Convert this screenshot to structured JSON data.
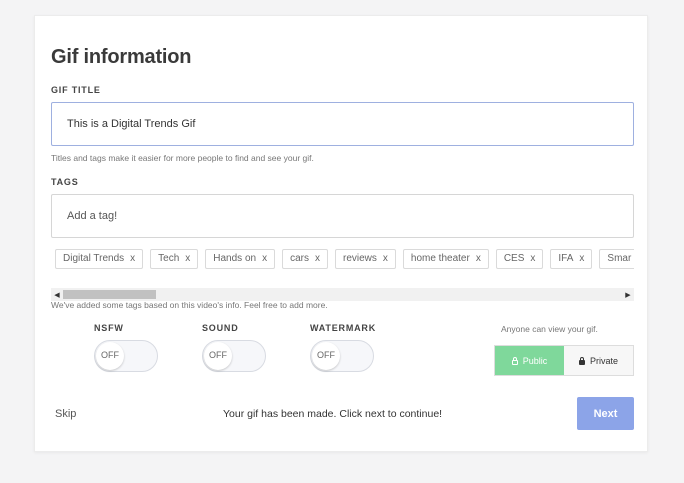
{
  "header": {
    "title": "Gif information"
  },
  "gif_title": {
    "label": "GIF TITLE",
    "value": "This is a Digital Trends Gif",
    "helper": "Titles and tags make it easier for more people to find and see your gif."
  },
  "tags": {
    "label": "TAGS",
    "placeholder": "Add a tag!",
    "remove_glyph": "x",
    "items": [
      "Digital Trends",
      "Tech",
      "Hands on",
      "cars",
      "reviews",
      "home theater",
      "CES",
      "IFA",
      "Smar"
    ],
    "helper": "We've added some tags based on this video's info. Feel free to add more."
  },
  "toggles": [
    {
      "label": "NSFW",
      "state": "OFF"
    },
    {
      "label": "SOUND",
      "state": "OFF"
    },
    {
      "label": "WATERMARK",
      "state": "OFF"
    }
  ],
  "privacy": {
    "note": "Anyone can view your gif.",
    "public_label": "Public",
    "private_label": "Private",
    "selected": "Public"
  },
  "footer": {
    "skip_label": "Skip",
    "status": "Your gif has been made. Click next to continue!",
    "next_label": "Next"
  },
  "colors": {
    "accent_next": "#8ca4e8",
    "public_selected": "#7fd89b",
    "focus_border": "#9eb0e0"
  }
}
